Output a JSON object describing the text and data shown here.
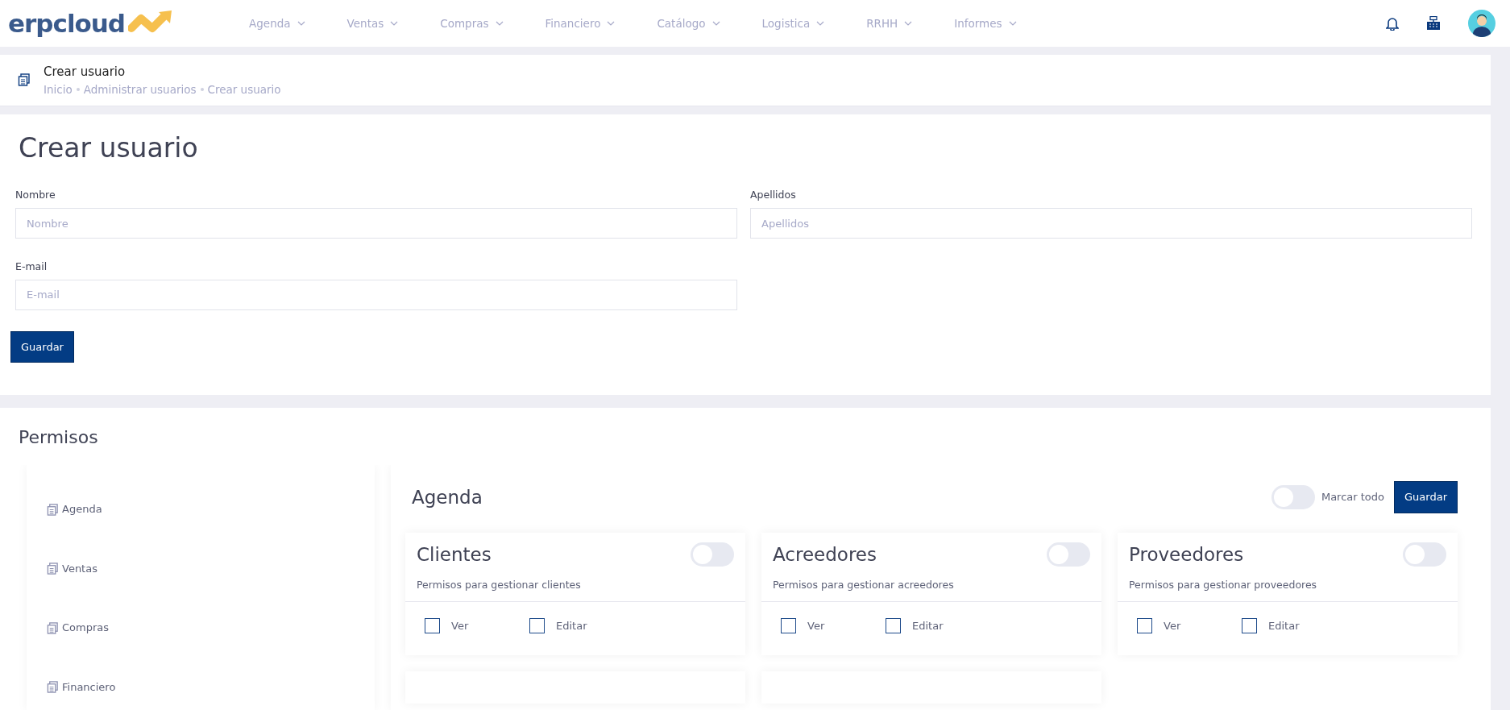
{
  "brand": {
    "text": "erpcloud"
  },
  "nav": [
    {
      "label": "Agenda"
    },
    {
      "label": "Ventas"
    },
    {
      "label": "Compras"
    },
    {
      "label": "Financiero"
    },
    {
      "label": "Catálogo"
    },
    {
      "label": "Logistica"
    },
    {
      "label": "RRHH"
    },
    {
      "label": "Informes"
    }
  ],
  "header": {
    "title": "Crear usuario",
    "breadcrumb": [
      "Inicio",
      "Administrar usuarios",
      "Crear usuario"
    ]
  },
  "form": {
    "title": "Crear usuario",
    "fields": [
      {
        "label": "Nombre",
        "placeholder": "Nombre"
      },
      {
        "label": "Apellidos",
        "placeholder": "Apellidos"
      },
      {
        "label": "E-mail",
        "placeholder": "E-mail"
      }
    ],
    "button": "Guardar"
  },
  "permissions": {
    "title": "Permisos",
    "sidebar": [
      {
        "label": "Agenda"
      },
      {
        "label": "Ventas"
      },
      {
        "label": "Compras"
      },
      {
        "label": "Financiero"
      }
    ],
    "panel": {
      "title": "Agenda",
      "mark_all": {
        "label": "Marcar todo",
        "on": false
      },
      "button": "Guardar",
      "cards": [
        {
          "title": "Clientes",
          "on": false,
          "description": "Permisos para gestionar clientes",
          "options": [
            {
              "label": "Ver",
              "checked": false
            },
            {
              "label": "Editar",
              "checked": false
            }
          ]
        },
        {
          "title": "Acreedores",
          "on": false,
          "description": "Permisos para gestionar acreedores",
          "options": [
            {
              "label": "Ver",
              "checked": false
            },
            {
              "label": "Editar",
              "checked": false
            }
          ]
        },
        {
          "title": "Proveedores",
          "on": false,
          "description": "Permisos para gestionar proveedores",
          "options": [
            {
              "label": "Ver",
              "checked": false
            },
            {
              "label": "Editar",
              "checked": false
            }
          ]
        }
      ]
    }
  }
}
